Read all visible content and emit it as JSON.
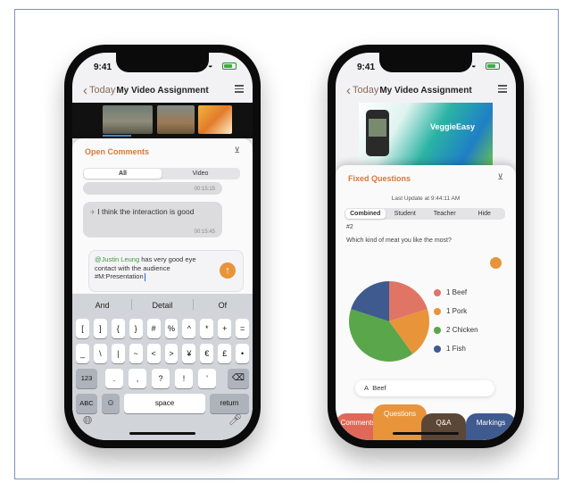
{
  "phone_left": {
    "status": {
      "time": "9:41"
    },
    "nav": {
      "back_label": "Today",
      "title": "My Video Assignment"
    },
    "panel": {
      "title": "Open Comments",
      "segments": [
        "All",
        "Video"
      ],
      "prev_time": "00:15:15",
      "comment": {
        "text": "I think the interaction is good",
        "time": "00:15:45"
      },
      "compose": {
        "mention": "@Justin Leung",
        "text_1": " has very good eye contact with the audience",
        "text_2": "#M:Presentation"
      }
    },
    "keyboard": {
      "suggestions": [
        "And",
        "Detail",
        "Of"
      ],
      "row1": [
        "[",
        "]",
        "{",
        "}",
        "#",
        "%",
        "^",
        "*",
        "+",
        "="
      ],
      "row2": [
        "_",
        "\\",
        "|",
        "~",
        "<",
        ">",
        "¥",
        "€",
        "£",
        "•"
      ],
      "row3_left": "123",
      "row3": [
        ".",
        ",",
        "?",
        "!",
        "’"
      ],
      "row4_left": "ABC",
      "space": "space",
      "return": "return"
    }
  },
  "phone_right": {
    "status": {
      "time": "9:41"
    },
    "nav": {
      "back_label": "Today",
      "title": "My Video Assignment"
    },
    "video_brand": "VeggieEasy",
    "panel": {
      "title": "Fixed Questions",
      "last_update": "Last Update at 9:44:11 AM",
      "segments": [
        "Combined",
        "Student",
        "Teacher",
        "Hide"
      ],
      "question_number": "#2",
      "question": "Which kind of meat you like the most?",
      "answer_prefix": "A",
      "answer": "Beef"
    },
    "tabs": [
      "Comments",
      "Questions",
      "Q&A",
      "Markings"
    ]
  },
  "chart_data": {
    "type": "pie",
    "categories": [
      "Beef",
      "Pork",
      "Chicken",
      "Fish"
    ],
    "values": [
      1,
      1,
      2,
      1
    ],
    "legend": [
      "1 Beef",
      "1 Pork",
      "2 Chicken",
      "1 Fish"
    ],
    "colors": [
      "#e07565",
      "#e8943a",
      "#5aa64a",
      "#3f5a8f"
    ],
    "legend_position": "right"
  }
}
